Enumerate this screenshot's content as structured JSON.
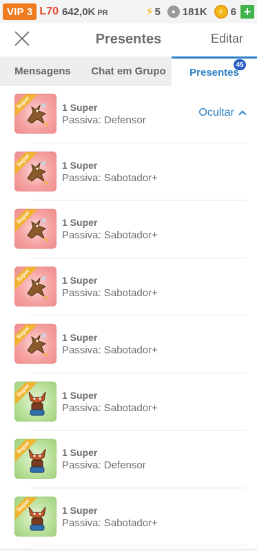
{
  "status": {
    "vip": "VIP 3",
    "level": "L70",
    "pr_value": "642,0K",
    "pr_unit": "PR",
    "energy": "5",
    "paws": "181K",
    "coins": "6",
    "plus": "+"
  },
  "header": {
    "title": "Presentes",
    "edit_label": "Editar"
  },
  "tabs": [
    {
      "label": "Mensagens"
    },
    {
      "label": "Chat em Grupo"
    },
    {
      "label": "Presentes",
      "badge": "45"
    }
  ],
  "hide_label": "Ocultar",
  "ribbon_label": "Super",
  "items": [
    {
      "name": "1 Super",
      "passive": "Passiva: Defensor",
      "theme": "red",
      "icon": "dragon-icon"
    },
    {
      "name": "1 Super",
      "passive": "Passiva: Sabotador+",
      "theme": "red",
      "icon": "dragon-icon"
    },
    {
      "name": "1 Super",
      "passive": "Passiva: Sabotador+",
      "theme": "red",
      "icon": "dragon-icon"
    },
    {
      "name": "1 Super",
      "passive": "Passiva: Sabotador+",
      "theme": "red",
      "icon": "dragon-icon"
    },
    {
      "name": "1 Super",
      "passive": "Passiva: Sabotador+",
      "theme": "red",
      "icon": "dragon-icon"
    },
    {
      "name": "1 Super",
      "passive": "Passiva: Sabotador+",
      "theme": "green",
      "icon": "fox-icon"
    },
    {
      "name": "1 Super",
      "passive": "Passiva: Defensor",
      "theme": "green",
      "icon": "fox-icon"
    },
    {
      "name": "1 Super",
      "passive": "Passiva: Sabotador+",
      "theme": "green",
      "icon": "fox-icon"
    }
  ]
}
